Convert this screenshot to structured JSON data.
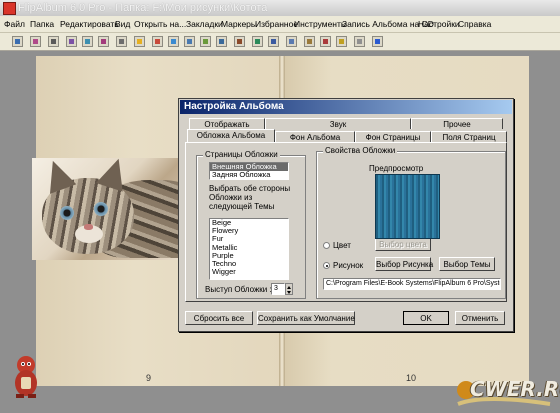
{
  "window": {
    "title": "FlipAlbum 6.0 Pro - Папка: F:\\Мои рисунки\\Котота"
  },
  "menu": [
    "Файл",
    "Папка",
    "Редактировать",
    "Вид",
    "Открыть на...",
    "Закладки",
    "Маркеры",
    "Избранное",
    "Инструменты",
    "Запись Альбома на CD",
    "Настройки",
    "Справка"
  ],
  "toolbar_icons": [
    "open-icon",
    "save-icon",
    "print-icon",
    "cut-icon",
    "copy-icon",
    "paste-icon",
    "undo-icon",
    "home-icon",
    "back-icon",
    "forward-icon",
    "end-icon",
    "zoom-icon",
    "grid-icon",
    "rotate-icon",
    "slideshow-icon",
    "music-icon",
    "edit-icon",
    "contents-icon",
    "index-icon",
    "stamp-icon",
    "cd-icon",
    "help-icon"
  ],
  "book": {
    "left_page_number": "9",
    "right_page_number": "10"
  },
  "watermark": {
    "text": "CWER.RU"
  },
  "dialog": {
    "title": "Настройка Альбома",
    "tabs_back": [
      "Отображать",
      "Звук",
      "Прочее"
    ],
    "tabs_front": [
      "Обложка Альбома",
      "Фон Альбома",
      "Фон Страницы",
      "Поля Страниц"
    ],
    "cover_pages": {
      "group_label": "Страницы Обложки",
      "items": [
        "Внешняя Обложка",
        "Задняя Обложка"
      ],
      "selected_index": 0,
      "hint": "Выбрать обе стороны Обложки из следующей Темы",
      "themes": [
        "Beige",
        "Flowery",
        "Fur",
        "Metallic",
        "Purple",
        "Techno",
        "Wigger"
      ],
      "offset_label": "Выступ Обложки :",
      "offset_value": "3"
    },
    "cover_props": {
      "group_label": "Свойства Обложки",
      "preview_label": "Предпросмотр",
      "radio_color": "Цвет",
      "radio_picture": "Рисунок",
      "selected_radio": "picture",
      "btn_choose_color": "Выбор цвета",
      "btn_choose_picture": "Выбор Рисунка",
      "btn_choose_theme": "Выбор Темы",
      "path": "C:\\Program Files\\E-Book Systems\\FlipAlbum 6 Pro\\Syste"
    },
    "buttons": {
      "reset_all": "Сбросить все",
      "save_default": "Сохранить как Умолчание",
      "ok": "OK",
      "cancel": "Отменить"
    }
  }
}
